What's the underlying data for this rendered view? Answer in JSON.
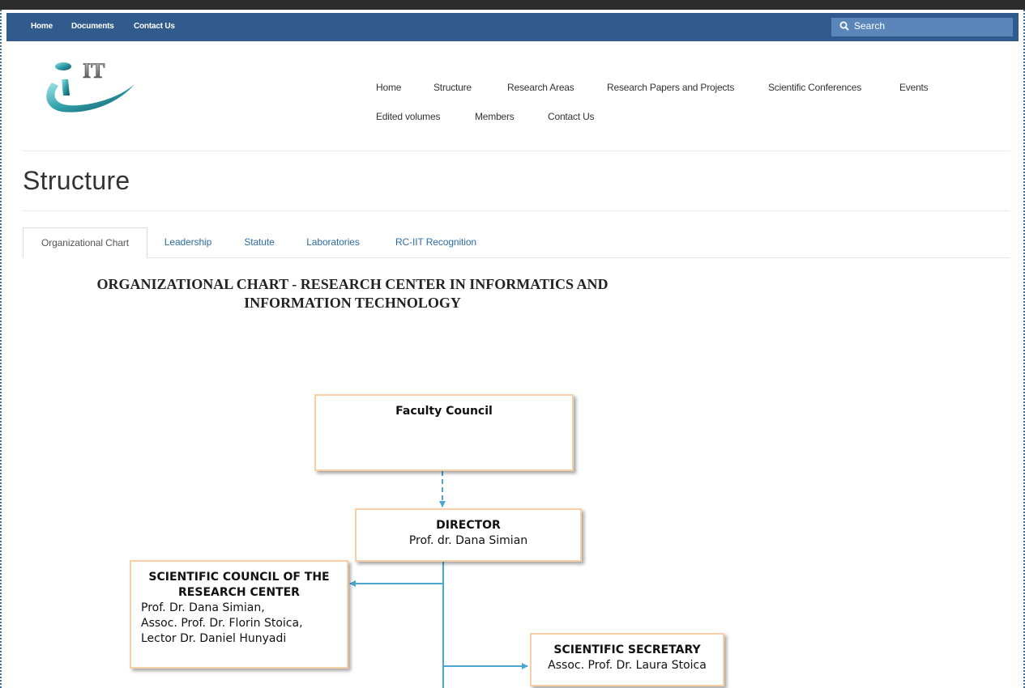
{
  "topbar": {
    "links": [
      "Home",
      "Documents",
      "Contact Us"
    ],
    "search_label": "Search"
  },
  "logo": {
    "text": "IT"
  },
  "main_nav": {
    "row1": [
      "Home",
      "Structure",
      "Research Areas",
      "Research Papers and Projects",
      "Scientific Conferences",
      "Events"
    ],
    "row2": [
      "Edited volumes",
      "Members",
      "Contact Us"
    ]
  },
  "page": {
    "title": "Structure"
  },
  "tabs": [
    "Organizational Chart",
    "Leadership",
    "Statute",
    "Laboratories",
    "RC-IIT Recognition"
  ],
  "org_chart": {
    "title_line1": "ORGANIZATIONAL CHART  - RESEARCH CENTER IN INFORMATICS AND",
    "title_line2": "INFORMATION TECHNOLOGY",
    "faculty_council": "Faculty Council",
    "director_title": "DIRECTOR",
    "director_name": "Prof. dr. Dana Simian",
    "scientific_council_title1": "SCIENTIFIC COUNCIL OF THE",
    "scientific_council_title2": "RESEARCH CENTER",
    "scientific_council_members": [
      "Prof. Dr. Dana Simian,",
      "Assoc. Prof. Dr. Florin Stoica,",
      "Lector Dr. Daniel Hunyadi"
    ],
    "secretary_title": "SCIENTIFIC SECRETARY",
    "secretary_name": "Assoc. Prof. Dr. Laura Stoica"
  },
  "colors": {
    "topbar": "#305b8c",
    "search": "#5a86ba",
    "box_border": "#f5d0a6",
    "connector": "#4aa8d0",
    "link": "#2c6ca3"
  }
}
